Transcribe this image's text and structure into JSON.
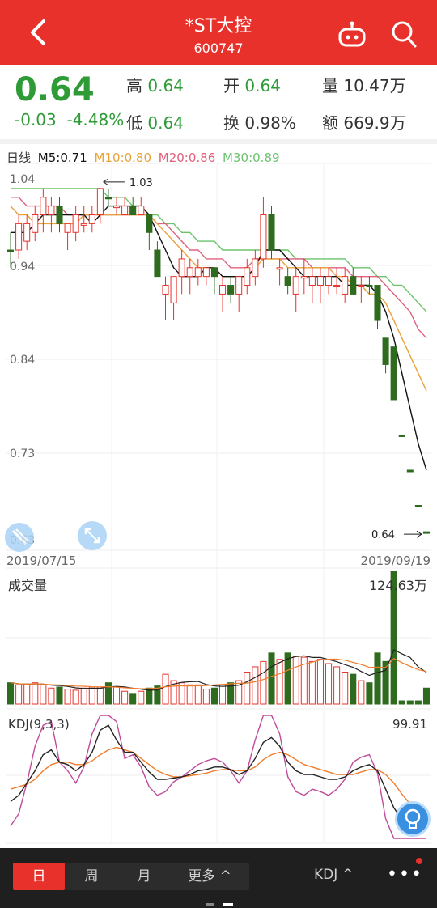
{
  "header": {
    "title": "*ST大控",
    "code": "600747"
  },
  "quote": {
    "price": "0.64",
    "change": "-0.03",
    "change_pct": "-4.48%",
    "high_label": "高",
    "high": "0.64",
    "open_label": "开",
    "open": "0.64",
    "volume_label": "量",
    "volume": "10.47万",
    "low_label": "低",
    "low": "0.64",
    "turnover_label": "换",
    "turnover": "0.98%",
    "amount_label": "额",
    "amount": "669.9万"
  },
  "ma_legend": {
    "period": "日线",
    "ma5": "M5:0.71",
    "ma10": "M10:0.80",
    "ma20": "M20:0.86",
    "ma30": "M30:0.89"
  },
  "colors": {
    "up": "#e8312a",
    "down": "#2e6b1f",
    "ma5": "#111111",
    "ma10": "#e8a23a",
    "ma20": "#e0607e",
    "ma30": "#6cc36c",
    "kdj_k": "#222222",
    "kdj_d": "#f07c2a",
    "kdj_j": "#c04a9a"
  },
  "price_axis": {
    "labels": [
      "1.04",
      "0.94",
      "0.84",
      "0.73",
      "0.63"
    ],
    "max_marker": "1.03",
    "last_marker": "0.64"
  },
  "dates": {
    "start": "2019/07/15",
    "end": "2019/09/19"
  },
  "volume_panel": {
    "title": "成交量",
    "max_label": "124.63万"
  },
  "kdj_panel": {
    "title": "KDJ(9,3,3)",
    "max_label": "99.91"
  },
  "chart_data": {
    "type": "candlestick",
    "ylim": [
      0.63,
      1.04
    ],
    "candles": [
      {
        "o": 0.96,
        "h": 0.98,
        "l": 0.94,
        "c": 0.96,
        "up": false
      },
      {
        "o": 0.96,
        "h": 1.0,
        "l": 0.95,
        "c": 0.99,
        "up": true
      },
      {
        "o": 0.97,
        "h": 1.0,
        "l": 0.96,
        "c": 0.99,
        "up": true
      },
      {
        "o": 0.98,
        "h": 1.01,
        "l": 0.97,
        "c": 1.0,
        "up": true
      },
      {
        "o": 1.0,
        "h": 1.03,
        "l": 0.98,
        "c": 1.02,
        "up": true
      },
      {
        "o": 1.01,
        "h": 1.02,
        "l": 0.98,
        "c": 1.0,
        "up": true
      },
      {
        "o": 1.01,
        "h": 1.02,
        "l": 0.98,
        "c": 0.99,
        "up": false
      },
      {
        "o": 0.99,
        "h": 0.99,
        "l": 0.96,
        "c": 0.98,
        "up": true
      },
      {
        "o": 0.98,
        "h": 1.01,
        "l": 0.97,
        "c": 1.0,
        "up": true
      },
      {
        "o": 0.99,
        "h": 1.01,
        "l": 0.98,
        "c": 0.99,
        "up": true
      },
      {
        "o": 0.99,
        "h": 1.01,
        "l": 0.98,
        "c": 1.0,
        "up": true
      },
      {
        "o": 1.0,
        "h": 1.03,
        "l": 0.99,
        "c": 1.03,
        "up": true
      },
      {
        "o": 1.02,
        "h": 1.03,
        "l": 1.01,
        "c": 1.02,
        "up": false
      },
      {
        "o": 1.01,
        "h": 1.02,
        "l": 1.0,
        "c": 1.01,
        "up": true
      },
      {
        "o": 1.01,
        "h": 1.02,
        "l": 1.0,
        "c": 1.0,
        "up": true
      },
      {
        "o": 1.01,
        "h": 1.02,
        "l": 1.0,
        "c": 1.0,
        "up": false
      },
      {
        "o": 1.01,
        "h": 1.02,
        "l": 1.0,
        "c": 1.0,
        "up": true
      },
      {
        "o": 1.0,
        "h": 1.0,
        "l": 0.96,
        "c": 0.98,
        "up": false
      },
      {
        "o": 0.96,
        "h": 0.97,
        "l": 0.93,
        "c": 0.93,
        "up": false
      },
      {
        "o": 0.92,
        "h": 0.93,
        "l": 0.88,
        "c": 0.91,
        "up": true
      },
      {
        "o": 0.9,
        "h": 0.93,
        "l": 0.88,
        "c": 0.93,
        "up": true
      },
      {
        "o": 0.93,
        "h": 0.96,
        "l": 0.91,
        "c": 0.95,
        "up": true
      },
      {
        "o": 0.93,
        "h": 0.95,
        "l": 0.91,
        "c": 0.94,
        "up": true
      },
      {
        "o": 0.93,
        "h": 0.95,
        "l": 0.92,
        "c": 0.94,
        "up": true
      },
      {
        "o": 0.93,
        "h": 0.94,
        "l": 0.92,
        "c": 0.94,
        "up": true
      },
      {
        "o": 0.94,
        "h": 0.94,
        "l": 0.91,
        "c": 0.93,
        "up": false
      },
      {
        "o": 0.91,
        "h": 0.93,
        "l": 0.89,
        "c": 0.92,
        "up": true
      },
      {
        "o": 0.92,
        "h": 0.93,
        "l": 0.9,
        "c": 0.91,
        "up": false
      },
      {
        "o": 0.91,
        "h": 0.93,
        "l": 0.89,
        "c": 0.93,
        "up": true
      },
      {
        "o": 0.92,
        "h": 0.95,
        "l": 0.91,
        "c": 0.94,
        "up": true
      },
      {
        "o": 0.93,
        "h": 0.96,
        "l": 0.92,
        "c": 0.95,
        "up": true
      },
      {
        "o": 0.95,
        "h": 1.02,
        "l": 0.94,
        "c": 1.0,
        "up": true
      },
      {
        "o": 1.0,
        "h": 1.01,
        "l": 0.95,
        "c": 0.96,
        "up": false
      },
      {
        "o": 0.94,
        "h": 0.95,
        "l": 0.92,
        "c": 0.94,
        "up": true
      },
      {
        "o": 0.93,
        "h": 0.94,
        "l": 0.91,
        "c": 0.92,
        "up": false
      },
      {
        "o": 0.91,
        "h": 0.94,
        "l": 0.89,
        "c": 0.93,
        "up": true
      },
      {
        "o": 0.93,
        "h": 0.95,
        "l": 0.91,
        "c": 0.93,
        "up": true
      },
      {
        "o": 0.92,
        "h": 0.94,
        "l": 0.9,
        "c": 0.93,
        "up": true
      },
      {
        "o": 0.92,
        "h": 0.94,
        "l": 0.9,
        "c": 0.93,
        "up": true
      },
      {
        "o": 0.92,
        "h": 0.94,
        "l": 0.91,
        "c": 0.93,
        "up": true
      },
      {
        "o": 0.92,
        "h": 0.94,
        "l": 0.91,
        "c": 0.92,
        "up": true
      },
      {
        "o": 0.91,
        "h": 0.94,
        "l": 0.9,
        "c": 0.93,
        "up": true
      },
      {
        "o": 0.93,
        "h": 0.94,
        "l": 0.91,
        "c": 0.91,
        "up": false
      },
      {
        "o": 0.92,
        "h": 0.93,
        "l": 0.9,
        "c": 0.92,
        "up": true
      },
      {
        "o": 0.92,
        "h": 0.93,
        "l": 0.91,
        "c": 0.92,
        "up": false
      },
      {
        "o": 0.92,
        "h": 0.92,
        "l": 0.87,
        "c": 0.88,
        "up": false
      },
      {
        "o": 0.86,
        "h": 0.86,
        "l": 0.82,
        "c": 0.83,
        "up": false
      },
      {
        "o": 0.85,
        "h": 0.85,
        "l": 0.79,
        "c": 0.79,
        "up": false
      },
      {
        "o": 0.75,
        "h": 0.75,
        "l": 0.75,
        "c": 0.75,
        "up": false
      },
      {
        "o": 0.71,
        "h": 0.71,
        "l": 0.71,
        "c": 0.71,
        "up": false
      },
      {
        "o": 0.67,
        "h": 0.67,
        "l": 0.67,
        "c": 0.67,
        "up": false
      },
      {
        "o": 0.64,
        "h": 0.64,
        "l": 0.64,
        "c": 0.64,
        "up": false
      }
    ],
    "volumes": [
      20,
      18,
      18,
      20,
      18,
      15,
      16,
      14,
      13,
      15,
      16,
      16,
      20,
      16,
      12,
      10,
      12,
      15,
      17,
      28,
      22,
      20,
      18,
      18,
      14,
      15,
      18,
      20,
      22,
      30,
      35,
      40,
      48,
      42,
      48,
      45,
      44,
      40,
      42,
      38,
      35,
      30,
      28,
      22,
      20,
      48,
      40,
      125,
      3,
      3,
      3,
      15
    ],
    "vol_max": 124.63,
    "ma5": [
      0.98,
      0.98,
      0.98,
      0.99,
      1.0,
      1.0,
      1.0,
      1.0,
      1.0,
      1.0,
      0.99,
      1.0,
      1.01,
      1.01,
      1.01,
      1.01,
      1.01,
      1.0,
      0.98,
      0.96,
      0.94,
      0.93,
      0.93,
      0.93,
      0.94,
      0.94,
      0.93,
      0.93,
      0.93,
      0.93,
      0.94,
      0.96,
      0.96,
      0.96,
      0.95,
      0.94,
      0.93,
      0.93,
      0.93,
      0.93,
      0.93,
      0.92,
      0.92,
      0.92,
      0.92,
      0.91,
      0.89,
      0.86,
      0.82,
      0.78,
      0.74,
      0.71
    ],
    "ma10": [
      1.01,
      1.0,
      1.0,
      0.99,
      0.99,
      0.99,
      0.99,
      0.99,
      0.99,
      1.0,
      1.0,
      1.0,
      1.0,
      1.0,
      1.0,
      1.0,
      1.0,
      1.0,
      0.99,
      0.98,
      0.97,
      0.96,
      0.95,
      0.94,
      0.94,
      0.94,
      0.93,
      0.93,
      0.93,
      0.93,
      0.94,
      0.95,
      0.95,
      0.95,
      0.94,
      0.94,
      0.94,
      0.94,
      0.94,
      0.94,
      0.93,
      0.93,
      0.92,
      0.92,
      0.91,
      0.91,
      0.9,
      0.88,
      0.86,
      0.84,
      0.82,
      0.8
    ],
    "ma20": [
      1.02,
      1.02,
      1.01,
      1.01,
      1.01,
      1.01,
      1.01,
      1.0,
      1.0,
      1.0,
      1.0,
      1.0,
      1.0,
      1.0,
      1.0,
      1.0,
      1.0,
      1.0,
      0.99,
      0.99,
      0.98,
      0.97,
      0.96,
      0.96,
      0.95,
      0.95,
      0.95,
      0.94,
      0.94,
      0.94,
      0.95,
      0.95,
      0.95,
      0.95,
      0.95,
      0.95,
      0.95,
      0.94,
      0.94,
      0.94,
      0.94,
      0.94,
      0.93,
      0.93,
      0.93,
      0.93,
      0.92,
      0.91,
      0.9,
      0.89,
      0.87,
      0.86
    ],
    "ma30": [
      1.03,
      1.03,
      1.03,
      1.03,
      1.03,
      1.03,
      1.03,
      1.03,
      1.03,
      1.03,
      1.03,
      1.03,
      1.02,
      1.02,
      1.02,
      1.01,
      1.01,
      1.0,
      1.0,
      0.99,
      0.99,
      0.98,
      0.98,
      0.97,
      0.97,
      0.97,
      0.96,
      0.96,
      0.96,
      0.96,
      0.96,
      0.96,
      0.96,
      0.96,
      0.96,
      0.95,
      0.95,
      0.95,
      0.95,
      0.95,
      0.95,
      0.95,
      0.94,
      0.94,
      0.94,
      0.93,
      0.93,
      0.92,
      0.92,
      0.91,
      0.9,
      0.89
    ],
    "kdj_k": [
      30,
      35,
      45,
      55,
      68,
      72,
      62,
      60,
      55,
      60,
      70,
      88,
      92,
      80,
      70,
      70,
      62,
      54,
      48,
      48,
      49,
      50,
      52,
      55,
      56,
      58,
      58,
      56,
      52,
      55,
      65,
      78,
      82,
      75,
      62,
      55,
      52,
      52,
      50,
      48,
      48,
      50,
      55,
      58,
      60,
      55,
      40,
      25,
      15,
      10,
      8,
      8
    ],
    "kdj_d": [
      40,
      42,
      44,
      48,
      55,
      60,
      62,
      62,
      60,
      60,
      63,
      68,
      72,
      74,
      72,
      70,
      65,
      60,
      55,
      52,
      50,
      50,
      51,
      52,
      53,
      55,
      56,
      56,
      55,
      55,
      58,
      64,
      68,
      70,
      68,
      64,
      60,
      58,
      56,
      54,
      52,
      52,
      52,
      54,
      56,
      56,
      52,
      45,
      36,
      28,
      20,
      15
    ],
    "kdj_j": [
      10,
      20,
      45,
      75,
      92,
      95,
      62,
      55,
      45,
      58,
      85,
      100,
      100,
      95,
      65,
      68,
      58,
      42,
      35,
      38,
      46,
      50,
      55,
      60,
      63,
      65,
      62,
      55,
      45,
      55,
      80,
      100,
      100,
      85,
      50,
      38,
      35,
      40,
      38,
      35,
      40,
      48,
      62,
      66,
      68,
      53,
      16,
      0,
      0,
      0,
      0,
      0
    ]
  },
  "tabs": {
    "day": "日",
    "week": "周",
    "month": "月",
    "more": "更多 ^",
    "indicator": "KDJ ^",
    "dots": "•••"
  }
}
